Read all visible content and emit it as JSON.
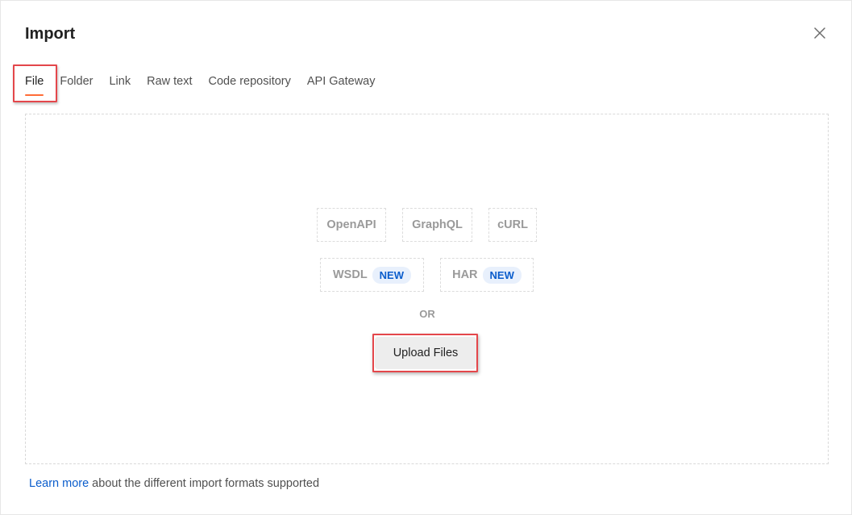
{
  "dialog": {
    "title": "Import"
  },
  "tabs": [
    {
      "label": "File",
      "active": true
    },
    {
      "label": "Folder",
      "active": false
    },
    {
      "label": "Link",
      "active": false
    },
    {
      "label": "Raw text",
      "active": false
    },
    {
      "label": "Code repository",
      "active": false
    },
    {
      "label": "API Gateway",
      "active": false
    }
  ],
  "formats": {
    "row1": [
      "OpenAPI",
      "GraphQL",
      "cURL"
    ],
    "wsdl": {
      "label": "WSDL",
      "badge": "NEW"
    },
    "har": {
      "label": "HAR",
      "badge": "NEW"
    }
  },
  "or_label": "OR",
  "upload_button": "Upload Files",
  "footer": {
    "link_text": "Learn more",
    "text": " about the different import formats supported"
  },
  "colors": {
    "accent_tab_underline": "#ff6c37",
    "highlight_border": "#e4474b",
    "badge_text": "#0b5dcc",
    "link": "#0b5dcc"
  },
  "icons": {
    "close": "close-icon"
  }
}
